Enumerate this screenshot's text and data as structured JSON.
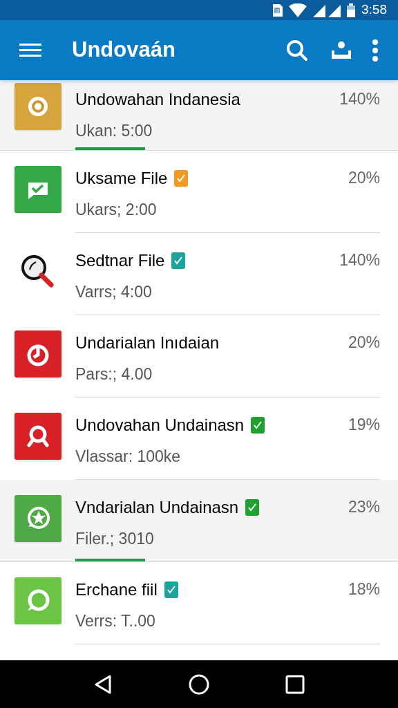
{
  "status_bar": {
    "time": "3:58"
  },
  "app_bar": {
    "title": "Undovaán"
  },
  "rows": [
    {
      "kind": "target",
      "title": "Undowahan Indanesia",
      "subtitle": "Ukan: 5:00",
      "percent": "140%",
      "checked": false,
      "level": 0.23
    },
    {
      "kind": "chat-check",
      "title": "Uksame File",
      "subtitle": "Ukars; 2:00",
      "percent": "20%",
      "checked": true,
      "color": "#f29a1f"
    },
    {
      "kind": "magnifier",
      "title": "Sedtnar File",
      "subtitle": "Varrs; 4:00",
      "percent": "140%",
      "checked": true,
      "color": "#1ba39c"
    },
    {
      "kind": "power",
      "title": "Undarialan Inıdaian",
      "subtitle": "Pars:; 4.00",
      "percent": "20%",
      "checked": false
    },
    {
      "kind": "search-doc",
      "title": "Undovahan Undainasn",
      "subtitle": "Vlassar: 100ke",
      "percent": "19%",
      "checked": true,
      "color": "#1fa12f"
    },
    {
      "kind": "star",
      "title": "Vndarialan Undainasn",
      "subtitle": "Filer.; 3010",
      "percent": "23%",
      "checked": true,
      "color": "#1fa12f",
      "level": 0.23
    },
    {
      "kind": "chat",
      "title": "Erchane fiil",
      "subtitle": "Verrs: T..00",
      "percent": "18%",
      "checked": true,
      "color": "#1ba39c"
    }
  ]
}
